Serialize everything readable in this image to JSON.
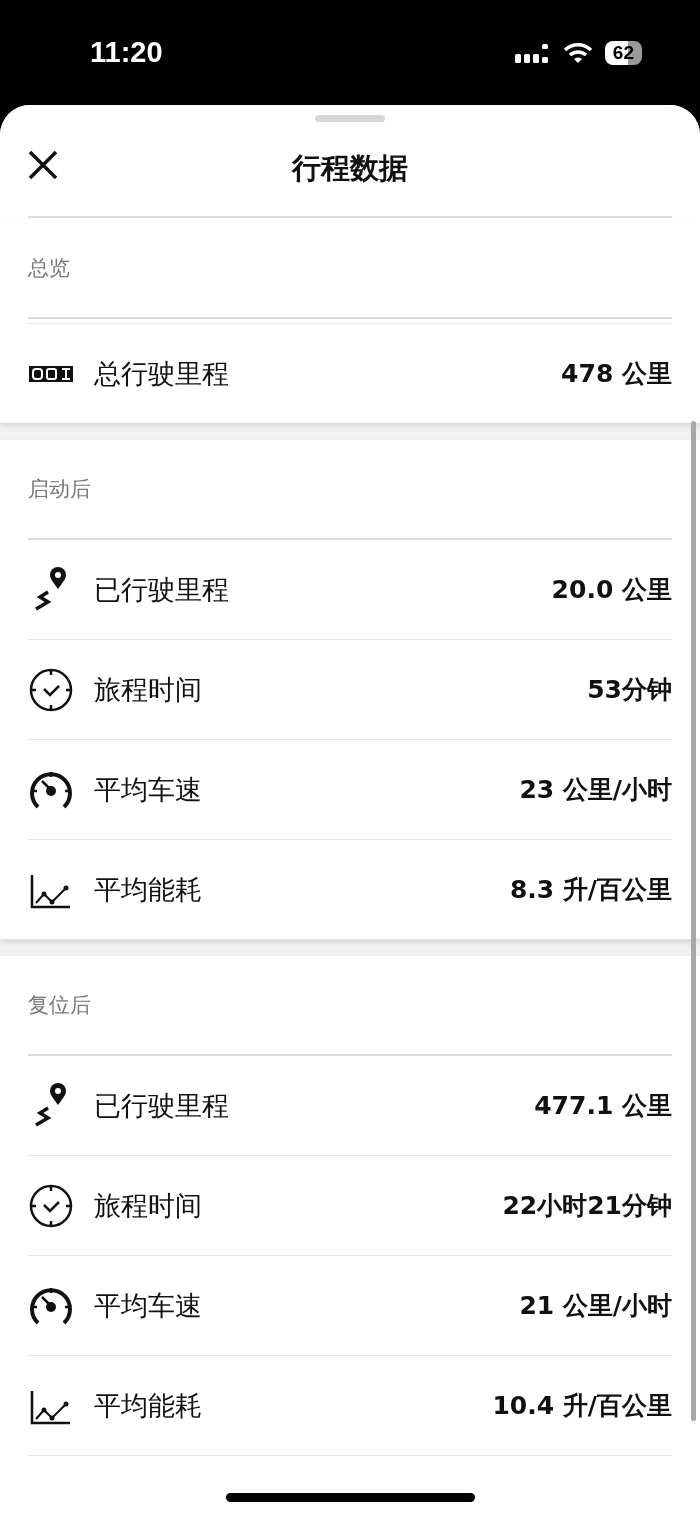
{
  "status_bar": {
    "time": "11:20",
    "battery": "62"
  },
  "title": "行程数据",
  "sections": [
    {
      "title": "总览",
      "rows": [
        {
          "kind": "odometer",
          "label": "总行驶里程",
          "value": "478 公里"
        }
      ]
    },
    {
      "title": "启动后",
      "rows": [
        {
          "kind": "route",
          "label": "已行驶里程",
          "value": "20.0 公里"
        },
        {
          "kind": "clock",
          "label": "旅程时间",
          "value": "53分钟"
        },
        {
          "kind": "speedometer",
          "label": "平均车速",
          "value": "23 公里/小时"
        },
        {
          "kind": "chart",
          "label": "平均能耗",
          "value": "8.3 升/百公里"
        }
      ]
    },
    {
      "title": "复位后",
      "rows": [
        {
          "kind": "route",
          "label": "已行驶里程",
          "value": "477.1 公里"
        },
        {
          "kind": "clock",
          "label": "旅程时间",
          "value": "22小时21分钟"
        },
        {
          "kind": "speedometer",
          "label": "平均车速",
          "value": "21 公里/小时"
        },
        {
          "kind": "chart",
          "label": "平均能耗",
          "value": "10.4 升/百公里"
        }
      ]
    }
  ]
}
